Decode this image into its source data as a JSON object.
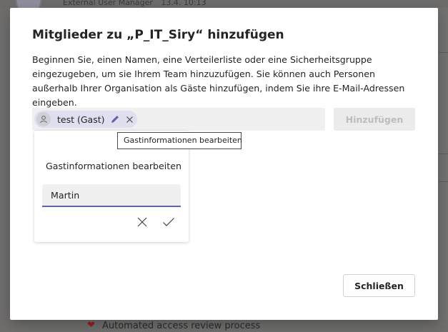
{
  "background": {
    "top_app_name": "External User Manager",
    "top_timestamp": "13.4. 10:13",
    "bottom_item_text": "Automated access review process",
    "bottom_item_icon": "heart-icon"
  },
  "dialog": {
    "title": "Mitglieder zu „P_IT_Siry“ hinzufügen",
    "description": "Beginnen Sie, einen Namen, eine Verteilerliste oder eine Sicherheitsgruppe eingezugeben, um sie Ihrem Team hinzuzufügen. Sie können auch Personen außerhalb Ihrer Organisation als Gäste hinzufügen, indem Sie ihre E-Mail-Adressen eingeben.",
    "picker": {
      "chip_label": "test (Gast)",
      "chip_icons": [
        "person-icon",
        "pencil-icon",
        "close-icon"
      ]
    },
    "add_button_label": "Hinzufügen",
    "tooltip_text": "Gastinformationen bearbeiten",
    "guest_popup": {
      "title": "Gastinformationen bearbeiten",
      "input_value": "Martin"
    },
    "close_button_label": "Schließen"
  },
  "colors": {
    "accent": "#6264a7",
    "chip_background": "#dfdff0",
    "disabled_text": "#bdbdbd"
  }
}
